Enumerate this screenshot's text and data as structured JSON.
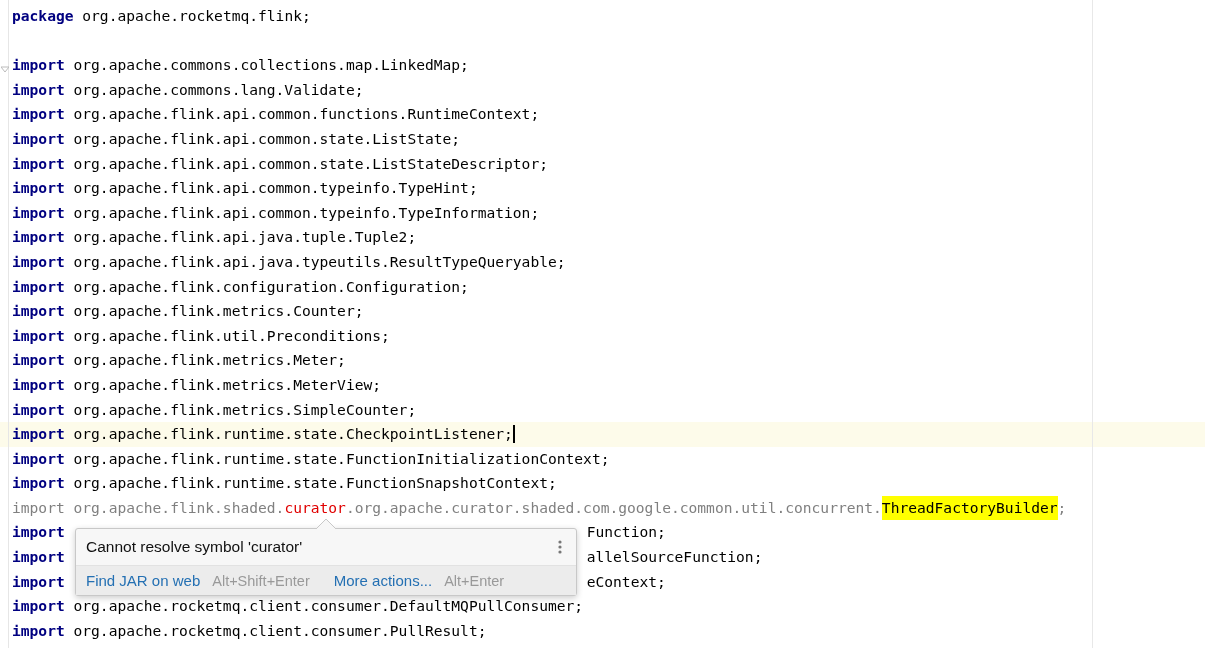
{
  "editor": {
    "lines": [
      {
        "current": false,
        "covered": false,
        "segments": [
          {
            "kind": "keyword",
            "text": "package"
          },
          {
            "kind": "plain",
            "text": " org.apache.rocketmq.flink;"
          }
        ]
      },
      {
        "current": false
      },
      {
        "current": false,
        "covered": false,
        "segments": [
          {
            "kind": "keyword",
            "text": "import"
          },
          {
            "kind": "plain",
            "text": " org.apache.commons.collections.map.LinkedMap;"
          }
        ]
      },
      {
        "current": false,
        "covered": false,
        "segments": [
          {
            "kind": "keyword",
            "text": "import"
          },
          {
            "kind": "plain",
            "text": " org.apache.commons.lang.Validate;"
          }
        ]
      },
      {
        "current": false,
        "covered": false,
        "segments": [
          {
            "kind": "keyword",
            "text": "import"
          },
          {
            "kind": "plain",
            "text": " org.apache.flink.api.common.functions.RuntimeContext;"
          }
        ]
      },
      {
        "current": false,
        "covered": false,
        "segments": [
          {
            "kind": "keyword",
            "text": "import"
          },
          {
            "kind": "plain",
            "text": " org.apache.flink.api.common.state.ListState;"
          }
        ]
      },
      {
        "current": false,
        "covered": false,
        "segments": [
          {
            "kind": "keyword",
            "text": "import"
          },
          {
            "kind": "plain",
            "text": " org.apache.flink.api.common.state.ListStateDescriptor;"
          }
        ]
      },
      {
        "current": false,
        "covered": false,
        "segments": [
          {
            "kind": "keyword",
            "text": "import"
          },
          {
            "kind": "plain",
            "text": " org.apache.flink.api.common.typeinfo.TypeHint;"
          }
        ]
      },
      {
        "current": false,
        "covered": false,
        "segments": [
          {
            "kind": "keyword",
            "text": "import"
          },
          {
            "kind": "plain",
            "text": " org.apache.flink.api.common.typeinfo.TypeInformation;"
          }
        ]
      },
      {
        "current": false,
        "covered": false,
        "segments": [
          {
            "kind": "keyword",
            "text": "import"
          },
          {
            "kind": "plain",
            "text": " org.apache.flink.api.java.tuple.Tuple2;"
          }
        ]
      },
      {
        "current": false,
        "covered": false,
        "segments": [
          {
            "kind": "keyword",
            "text": "import"
          },
          {
            "kind": "plain",
            "text": " org.apache.flink.api.java.typeutils.ResultTypeQueryable;"
          }
        ]
      },
      {
        "current": false,
        "covered": false,
        "segments": [
          {
            "kind": "keyword",
            "text": "import"
          },
          {
            "kind": "plain",
            "text": " org.apache.flink.configuration.Configuration;"
          }
        ]
      },
      {
        "current": false,
        "covered": false,
        "segments": [
          {
            "kind": "keyword",
            "text": "import"
          },
          {
            "kind": "plain",
            "text": " org.apache.flink.metrics.Counter;"
          }
        ]
      },
      {
        "current": false,
        "covered": false,
        "segments": [
          {
            "kind": "keyword",
            "text": "import"
          },
          {
            "kind": "plain",
            "text": " org.apache.flink.util.Preconditions;"
          }
        ]
      },
      {
        "current": false,
        "covered": false,
        "segments": [
          {
            "kind": "keyword",
            "text": "import"
          },
          {
            "kind": "plain",
            "text": " org.apache.flink.metrics.Meter;"
          }
        ]
      },
      {
        "current": false,
        "covered": false,
        "segments": [
          {
            "kind": "keyword",
            "text": "import"
          },
          {
            "kind": "plain",
            "text": " org.apache.flink.metrics.MeterView;"
          }
        ]
      },
      {
        "current": false,
        "covered": false,
        "segments": [
          {
            "kind": "keyword",
            "text": "import"
          },
          {
            "kind": "plain",
            "text": " org.apache.flink.metrics.SimpleCounter;"
          }
        ]
      },
      {
        "current": true,
        "covered": false,
        "segments": [
          {
            "kind": "keyword",
            "text": "import"
          },
          {
            "kind": "plain",
            "text": " org.apache.flink.runtime.state.CheckpointListener;"
          }
        ]
      },
      {
        "current": false,
        "covered": false,
        "segments": [
          {
            "kind": "keyword",
            "text": "import"
          },
          {
            "kind": "plain",
            "text": " org.apache.flink.runtime.state.FunctionInitializationContext;"
          }
        ]
      },
      {
        "current": false,
        "covered": false,
        "segments": [
          {
            "kind": "keyword",
            "text": "import"
          },
          {
            "kind": "plain",
            "text": " org.apache.flink.runtime.state.FunctionSnapshotContext;"
          }
        ]
      },
      {
        "current": false,
        "covered": false,
        "segments": [
          {
            "kind": "unused",
            "text": "import org.apache.flink.shaded."
          },
          {
            "kind": "error",
            "text": "curator"
          },
          {
            "kind": "unused",
            "text": ".org.apache.curator.shaded.com.google.common.util.concurrent."
          },
          {
            "kind": "highlight",
            "text": "ThreadFactoryBuilder"
          },
          {
            "kind": "unused",
            "text": ";"
          }
        ]
      },
      {
        "current": false,
        "covered": true,
        "segments": [
          {
            "kind": "keyword",
            "text": "import"
          },
          {
            "kind": "plain",
            "text": "Function;"
          }
        ]
      },
      {
        "current": false,
        "covered": true,
        "segments": [
          {
            "kind": "keyword",
            "text": "import"
          },
          {
            "kind": "plain",
            "text": "allelSourceFunction;"
          }
        ]
      },
      {
        "current": false,
        "covered": true,
        "segments": [
          {
            "kind": "keyword",
            "text": "import"
          },
          {
            "kind": "plain",
            "text": "eContext;"
          }
        ]
      },
      {
        "current": false,
        "covered": false,
        "segments": [
          {
            "kind": "keyword",
            "text": "import"
          },
          {
            "kind": "plain",
            "text": " org.apache.rocketmq.client.consumer.DefaultMQPullConsumer;"
          }
        ]
      },
      {
        "current": false,
        "covered": false,
        "segments": [
          {
            "kind": "keyword",
            "text": "import"
          },
          {
            "kind": "plain",
            "text": " org.apache.rocketmq.client.consumer.PullResult;"
          }
        ]
      }
    ]
  },
  "popup": {
    "message": "Cannot resolve symbol 'curator'",
    "actions": [
      {
        "label": "Find JAR on web",
        "shortcut": "Alt+Shift+Enter"
      },
      {
        "label": "More actions...",
        "shortcut": "Alt+Enter"
      }
    ]
  }
}
